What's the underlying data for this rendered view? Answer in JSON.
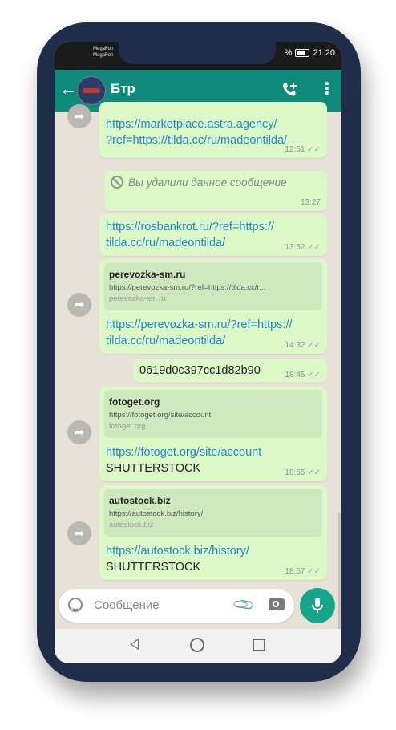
{
  "status_bar": {
    "carrier_1": "MegaFon",
    "carrier_2": "MegaFon",
    "battery_label": "%",
    "time": "21:20"
  },
  "header": {
    "title": "Бтр",
    "back_icon": "arrow-left-icon",
    "call_icon": "add-call-icon",
    "menu_icon": "more-vertical-icon"
  },
  "messages": [
    {
      "text_1": "https://marketplace.astra.agency/",
      "text_2": "?ref=https://tilda.cc/ru/madeontilda/",
      "time": "12:51"
    },
    {
      "text": "Вы удалили данное сообщение",
      "time": "13:27"
    },
    {
      "text_1": "https://rosbankrot.ru/?ref=https://",
      "text_2": "tilda.cc/ru/madeontilda/",
      "time": "13:52"
    },
    {
      "preview": {
        "title": "perevozka-sm.ru",
        "url": "https://perevozka-sm.ru/?ref=https://tilda.cc/r...",
        "domain": "perevozka-sm.ru"
      },
      "text_1": "https://perevozka-sm.ru/?ref=https://",
      "text_2": "tilda.cc/ru/madeontilda/",
      "time": "14:32"
    },
    {
      "text": "0619d0c397cc1d82b90",
      "time": "18:45"
    },
    {
      "preview": {
        "title": "fotoget.org",
        "url": "https://fotoget.org/site/account",
        "domain": "fotoget.org"
      },
      "text_1": "https://fotoget.org/site/account",
      "text_2": "SHUTTERSTOCK",
      "time": "18:55"
    },
    {
      "preview": {
        "title": "autostock.biz",
        "url": "https://autostock.biz/history/",
        "domain": "autostock.biz"
      },
      "text_1": "https://autostock.biz/history/",
      "text_2": "SHUTTERSTOCK",
      "time": "18:57"
    }
  ],
  "composer": {
    "placeholder": "Сообщение",
    "emoji_icon": "emoji-icon",
    "attach_icon": "paperclip-icon",
    "camera_icon": "camera-icon",
    "mic_icon": "microphone-icon"
  },
  "colors": {
    "app_bar": "#0f8a7a",
    "bubble_out": "#dcf8c6",
    "link": "#1e88c8",
    "mic_button": "#15a58a",
    "chat_background": "#e7e1d7",
    "phone_frame": "#1f2d4a"
  }
}
